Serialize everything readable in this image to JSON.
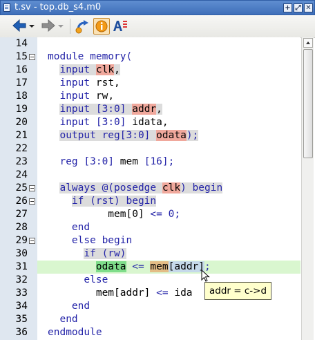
{
  "window": {
    "title": "t.sv - top.db_s4.m0"
  },
  "title_buttons": [
    {
      "name": "maximize-button",
      "glyph": "+"
    },
    {
      "name": "restore-button",
      "glyph": "⤢"
    },
    {
      "name": "close-button",
      "glyph": "✕"
    }
  ],
  "toolbar": {
    "icons": [
      "back-arrow-icon",
      "back-dropdown-icon",
      "forward-arrow-icon",
      "forward-dropdown-icon",
      "trace-driver-icon",
      "info-icon",
      "font-ab-icon"
    ],
    "info_active": true
  },
  "editor": {
    "lines": [
      {
        "num": "14",
        "fold": false,
        "active": false,
        "segments": []
      },
      {
        "num": "15",
        "fold": true,
        "active": false,
        "segments": [
          {
            "t": "module memory(",
            "c": "kw"
          }
        ]
      },
      {
        "num": "16",
        "fold": false,
        "active": false,
        "segments": [
          {
            "t": "  "
          },
          {
            "t": "input ",
            "c": "kw bg-g"
          },
          {
            "t": "clk",
            "c": "hl-r"
          },
          {
            "t": ",",
            "c": "bg-g"
          }
        ]
      },
      {
        "num": "17",
        "fold": false,
        "active": false,
        "segments": [
          {
            "t": "  "
          },
          {
            "t": "input",
            "c": "kw"
          },
          {
            "t": " rst,"
          }
        ]
      },
      {
        "num": "18",
        "fold": false,
        "active": false,
        "segments": [
          {
            "t": "  "
          },
          {
            "t": "input",
            "c": "kw"
          },
          {
            "t": " rw,"
          }
        ]
      },
      {
        "num": "19",
        "fold": false,
        "active": false,
        "segments": [
          {
            "t": "  "
          },
          {
            "t": "input [3:0] ",
            "c": "kw bg-g"
          },
          {
            "t": "addr",
            "c": "hl-r"
          },
          {
            "t": ",",
            "c": "bg-g"
          }
        ]
      },
      {
        "num": "20",
        "fold": false,
        "active": false,
        "segments": [
          {
            "t": "  "
          },
          {
            "t": "input",
            "c": "kw"
          },
          {
            "t": " "
          },
          {
            "t": "[3:0]",
            "c": "kw"
          },
          {
            "t": " idata,"
          }
        ]
      },
      {
        "num": "21",
        "fold": false,
        "active": false,
        "segments": [
          {
            "t": "  "
          },
          {
            "t": "output reg[3:0] ",
            "c": "kw bg-g"
          },
          {
            "t": "odata",
            "c": "hl-r"
          },
          {
            "t": ");",
            "c": "kw bg-g"
          }
        ]
      },
      {
        "num": "22",
        "fold": false,
        "active": false,
        "segments": []
      },
      {
        "num": "23",
        "fold": false,
        "active": false,
        "segments": [
          {
            "t": "  "
          },
          {
            "t": "reg",
            "c": "kw"
          },
          {
            "t": " "
          },
          {
            "t": "[3:0]",
            "c": "kw"
          },
          {
            "t": " mem "
          },
          {
            "t": "[16];",
            "c": "kw"
          }
        ]
      },
      {
        "num": "24",
        "fold": false,
        "active": false,
        "segments": []
      },
      {
        "num": "25",
        "fold": true,
        "active": false,
        "segments": [
          {
            "t": "  "
          },
          {
            "t": "always @(posedge ",
            "c": "kw bg-g"
          },
          {
            "t": "clk",
            "c": "hl-r"
          },
          {
            "t": ") begin",
            "c": "kw bg-g"
          }
        ]
      },
      {
        "num": "26",
        "fold": true,
        "active": false,
        "segments": [
          {
            "t": "    "
          },
          {
            "t": "if (rst) begin",
            "c": "kw bg-g"
          }
        ]
      },
      {
        "num": "27",
        "fold": false,
        "active": false,
        "segments": [
          {
            "t": "          mem[0] "
          },
          {
            "t": "<=",
            "c": "kw"
          },
          {
            "t": " "
          },
          {
            "t": "0;",
            "c": "kw"
          }
        ]
      },
      {
        "num": "28",
        "fold": false,
        "active": false,
        "segments": [
          {
            "t": "    "
          },
          {
            "t": "end",
            "c": "kw"
          }
        ]
      },
      {
        "num": "29",
        "fold": true,
        "active": false,
        "segments": [
          {
            "t": "    "
          },
          {
            "t": "else begin",
            "c": "kw"
          }
        ]
      },
      {
        "num": "30",
        "fold": false,
        "active": false,
        "segments": [
          {
            "t": "      "
          },
          {
            "t": "if (rw)",
            "c": "kw bg-g"
          }
        ]
      },
      {
        "num": "31",
        "fold": false,
        "active": true,
        "segments": [
          {
            "t": "        "
          },
          {
            "t": "odata",
            "c": "hl-g"
          },
          {
            "t": " <= ",
            "c": "kw"
          },
          {
            "t": "mem",
            "c": "hl-o"
          },
          {
            "t": "[addr]",
            "c": "hl-b"
          },
          {
            "t": ";",
            "c": "kw"
          }
        ]
      },
      {
        "num": "32",
        "fold": false,
        "active": false,
        "segments": [
          {
            "t": "      "
          },
          {
            "t": "else",
            "c": "kw"
          }
        ]
      },
      {
        "num": "33",
        "fold": false,
        "active": false,
        "segments": [
          {
            "t": "        mem[addr] "
          },
          {
            "t": "<=",
            "c": "kw"
          },
          {
            "t": " ida"
          }
        ]
      },
      {
        "num": "34",
        "fold": false,
        "active": false,
        "segments": [
          {
            "t": "    "
          },
          {
            "t": "end",
            "c": "kw"
          }
        ]
      },
      {
        "num": "35",
        "fold": false,
        "active": false,
        "segments": [
          {
            "t": "  "
          },
          {
            "t": "end",
            "c": "kw"
          }
        ]
      },
      {
        "num": "36",
        "fold": false,
        "active": false,
        "segments": [
          {
            "t": "endmodule",
            "c": "kw"
          }
        ]
      }
    ]
  },
  "tooltip": {
    "text": "addr = c->d"
  },
  "colors": {
    "keyword": "#2424a8",
    "signal_highlight": "#f0a89c",
    "driver_highlight": "#7fdd8a",
    "active_line": "#d9f6cf",
    "gutter": "#dfe7f0",
    "tooltip_bg": "#ffffcc"
  }
}
